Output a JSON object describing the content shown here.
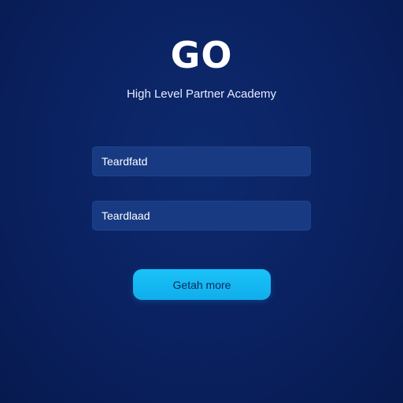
{
  "brand": {
    "logo_text": "GO",
    "subtitle": "High Level Partner Academy"
  },
  "form": {
    "field_1": {
      "value": "Teardfatd"
    },
    "field_2": {
      "value": "Teardlaad"
    },
    "submit_label": "Getah more"
  },
  "colors": {
    "background": "#0a2160",
    "field_background": "#173a83",
    "button_background": "#14b8f2",
    "button_text": "#0b2a60"
  }
}
